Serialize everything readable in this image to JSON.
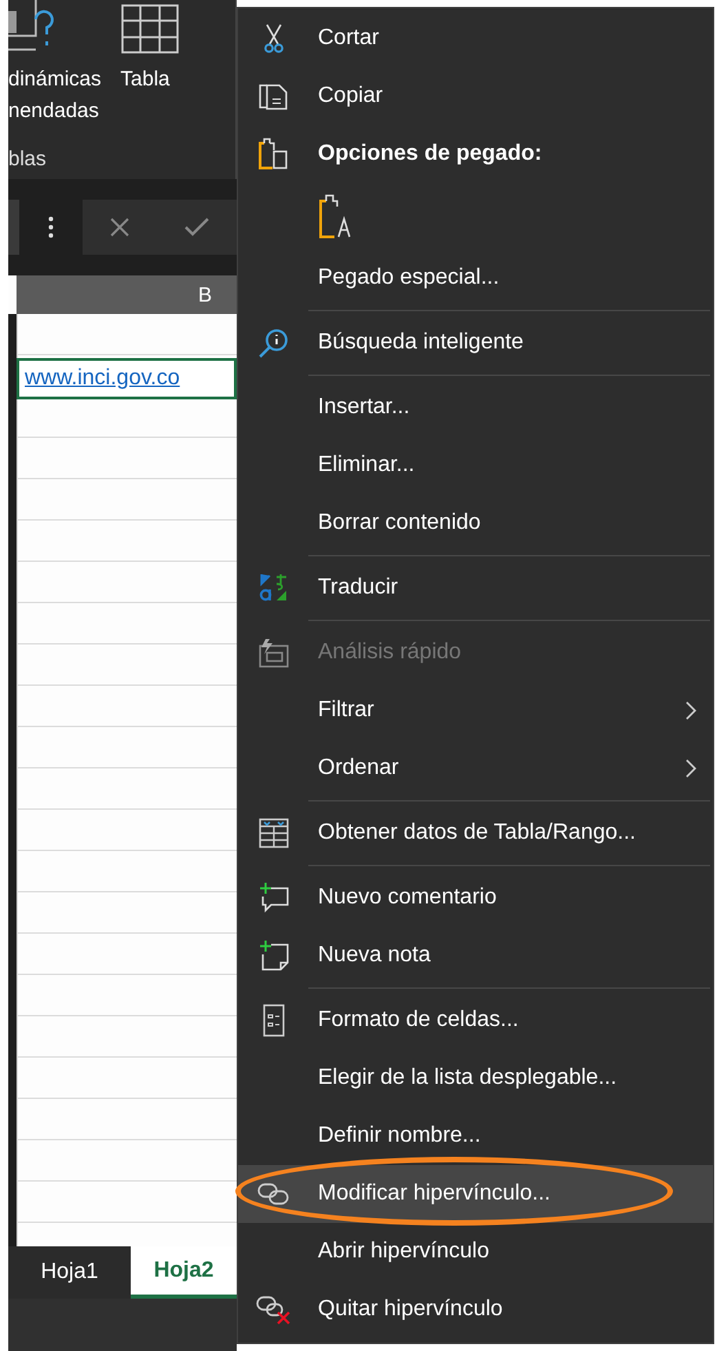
{
  "ribbon": {
    "buttons": [
      {
        "label_lines": [
          "dinámicas",
          "nendadas"
        ]
      },
      {
        "label_lines": [
          "Tabla"
        ]
      }
    ],
    "group_label": "blas"
  },
  "sheet": {
    "column_header": "B",
    "cell": {
      "value": "www.inci.gov.co",
      "selected": true
    }
  },
  "sheet_tabs": [
    {
      "label": "Hoja1",
      "selected": false
    },
    {
      "label": "Hoja2",
      "selected": true
    }
  ],
  "context_menu": {
    "items": [
      {
        "kind": "item",
        "label": "Cortar",
        "disabled": false,
        "submenu": false,
        "selected": false,
        "circled": false
      },
      {
        "kind": "item",
        "label": "Copiar",
        "disabled": false,
        "submenu": false,
        "selected": false,
        "circled": false
      },
      {
        "kind": "heading",
        "label": "Opciones de pegado:"
      },
      {
        "kind": "paste-option"
      },
      {
        "kind": "item",
        "label": "Pegado especial...",
        "disabled": false,
        "submenu": false,
        "selected": false,
        "circled": false
      },
      {
        "kind": "separator"
      },
      {
        "kind": "item",
        "label": "Búsqueda inteligente",
        "disabled": false,
        "submenu": false,
        "selected": false,
        "circled": false
      },
      {
        "kind": "separator"
      },
      {
        "kind": "item",
        "label": "Insertar...",
        "disabled": false,
        "submenu": false,
        "selected": false,
        "circled": false
      },
      {
        "kind": "item",
        "label": "Eliminar...",
        "disabled": false,
        "submenu": false,
        "selected": false,
        "circled": false
      },
      {
        "kind": "item",
        "label": "Borrar contenido",
        "disabled": false,
        "submenu": false,
        "selected": false,
        "circled": false
      },
      {
        "kind": "separator"
      },
      {
        "kind": "item",
        "label": "Traducir",
        "disabled": false,
        "submenu": false,
        "selected": false,
        "circled": false
      },
      {
        "kind": "separator"
      },
      {
        "kind": "item",
        "label": "Análisis rápido",
        "disabled": true,
        "submenu": false,
        "selected": false,
        "circled": false
      },
      {
        "kind": "item",
        "label": "Filtrar",
        "disabled": false,
        "submenu": true,
        "selected": false,
        "circled": false
      },
      {
        "kind": "item",
        "label": "Ordenar",
        "disabled": false,
        "submenu": true,
        "selected": false,
        "circled": false
      },
      {
        "kind": "separator"
      },
      {
        "kind": "item",
        "label": "Obtener datos de Tabla/Rango...",
        "disabled": false,
        "submenu": false,
        "selected": false,
        "circled": false
      },
      {
        "kind": "separator"
      },
      {
        "kind": "item",
        "label": "Nuevo comentario",
        "disabled": false,
        "submenu": false,
        "selected": false,
        "circled": false
      },
      {
        "kind": "item",
        "label": "Nueva nota",
        "disabled": false,
        "submenu": false,
        "selected": false,
        "circled": false
      },
      {
        "kind": "separator"
      },
      {
        "kind": "item",
        "label": "Formato de celdas...",
        "disabled": false,
        "submenu": false,
        "selected": false,
        "circled": false
      },
      {
        "kind": "item",
        "label": "Elegir de la lista desplegable...",
        "disabled": false,
        "submenu": false,
        "selected": false,
        "circled": false
      },
      {
        "kind": "item",
        "label": "Definir nombre...",
        "disabled": false,
        "submenu": false,
        "selected": false,
        "circled": false
      },
      {
        "kind": "item",
        "label": "Modificar hipervínculo...",
        "disabled": false,
        "submenu": false,
        "selected": true,
        "circled": true
      },
      {
        "kind": "item",
        "label": "Abrir hipervínculo",
        "disabled": false,
        "submenu": false,
        "selected": false,
        "circled": false
      },
      {
        "kind": "item",
        "label": "Quitar hipervínculo",
        "disabled": false,
        "submenu": false,
        "selected": false,
        "circled": false
      }
    ]
  }
}
